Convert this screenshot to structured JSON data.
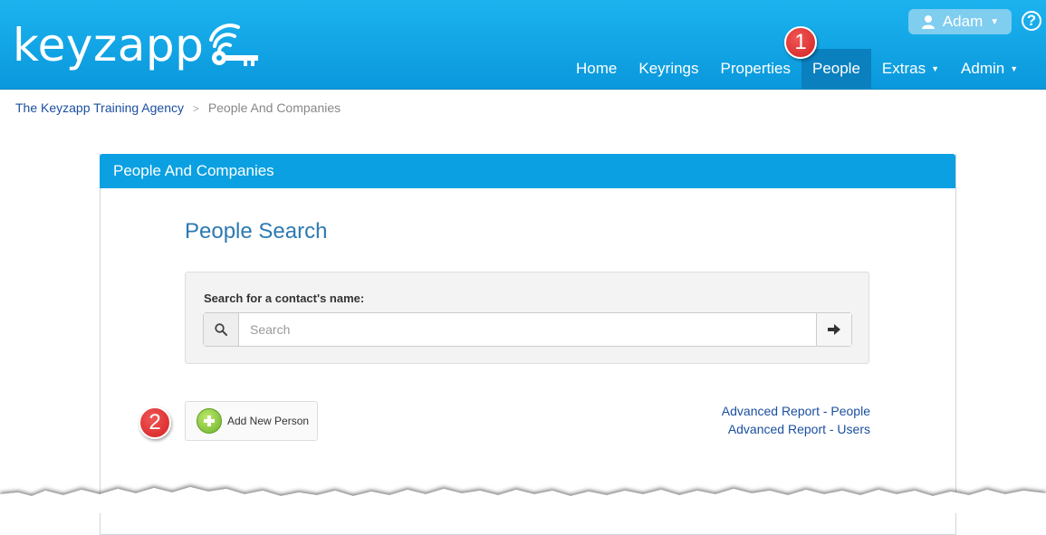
{
  "header": {
    "logo_text": "keyzapp",
    "user": {
      "name": "Adam"
    },
    "nav": [
      {
        "label": "Home",
        "active": false,
        "dropdown": false
      },
      {
        "label": "Keyrings",
        "active": false,
        "dropdown": false
      },
      {
        "label": "Properties",
        "active": false,
        "dropdown": false
      },
      {
        "label": "People",
        "active": true,
        "dropdown": false
      },
      {
        "label": "Extras",
        "active": false,
        "dropdown": true
      },
      {
        "label": "Admin",
        "active": false,
        "dropdown": true
      }
    ]
  },
  "annotations": {
    "badge1": "1",
    "badge2": "2"
  },
  "breadcrumb": {
    "root": "The Keyzapp Training Agency",
    "separator": ">",
    "current": "People And Companies"
  },
  "panel": {
    "heading": "People And Companies"
  },
  "search": {
    "title": "People Search",
    "label": "Search for a contact's name:",
    "placeholder": "Search"
  },
  "actions": {
    "add_person": "Add New Person",
    "report_people": "Advanced Report - People",
    "report_users": "Advanced Report - Users"
  },
  "colors": {
    "header_bg": "#0aa0e2",
    "nav_active": "#0a80bf",
    "link": "#1b4fa0",
    "title_blue": "#2d7ab1",
    "badge_red": "#d42222"
  }
}
